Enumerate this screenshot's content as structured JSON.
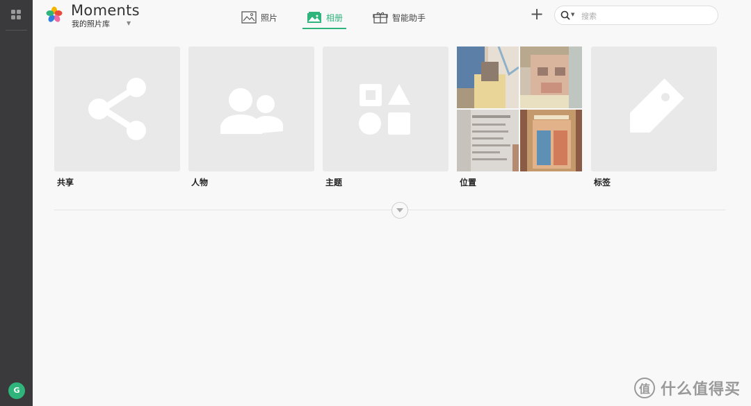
{
  "app": {
    "title": "Moments",
    "library": "我的照片库"
  },
  "tabs": [
    {
      "label": "照片",
      "icon": "photo-icon",
      "active": false
    },
    {
      "label": "相册",
      "icon": "album-icon",
      "active": true
    },
    {
      "label": "智能助手",
      "icon": "gift-icon",
      "active": false
    }
  ],
  "search": {
    "placeholder": "搜索",
    "value": ""
  },
  "albums": [
    {
      "label": "共享",
      "icon": "share-icon"
    },
    {
      "label": "人物",
      "icon": "people-icon"
    },
    {
      "label": "主题",
      "icon": "shapes-icon"
    },
    {
      "label": "位置",
      "icon": "photo-mosaic"
    },
    {
      "label": "标签",
      "icon": "tag-icon"
    }
  ],
  "user": {
    "initial": "G"
  },
  "watermark": {
    "glyph": "值",
    "text": "什么值得买"
  },
  "colors": {
    "accent": "#2fb47c",
    "rail": "#3a3a3c",
    "card": "#e9e9e9"
  }
}
